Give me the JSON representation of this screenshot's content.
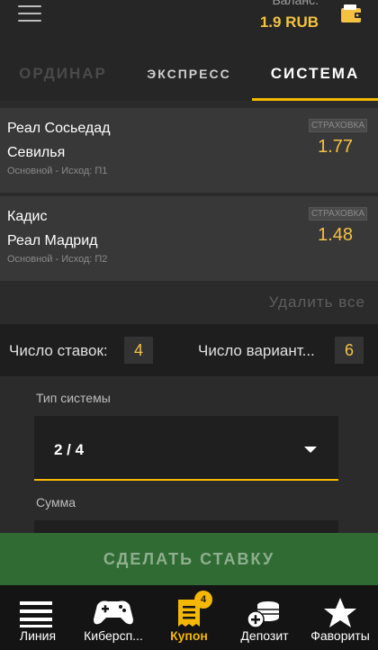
{
  "header": {
    "balance_label": "Баланс:",
    "balance_value": "1.9 RUB"
  },
  "tabs": [
    {
      "label": "ОРДИНАР"
    },
    {
      "label": "ЭКСПРЕСС"
    },
    {
      "label": "СИСТЕМА",
      "active": true
    }
  ],
  "bets": [
    {
      "team_a": "Реал Сосьедад",
      "team_b": "Севилья",
      "desc": "Основной - Исход: П1",
      "insurance": "СТРАХОВКА",
      "odds": "1.77"
    },
    {
      "team_a": "Кадис",
      "team_b": "Реал Мадрид",
      "desc": "Основной - Исход: П2",
      "insurance": "СТРАХОВКА",
      "odds": "1.48"
    }
  ],
  "delete_all": "Удалить все",
  "counts": {
    "bets_label": "Число ставок:",
    "bets_value": "4",
    "variants_label": "Число вариант...",
    "variants_value": "6"
  },
  "form": {
    "system_type_label": "Тип системы",
    "system_type_value": "2 / 4",
    "amount_label": "Сумма"
  },
  "submit_label": "СДЕЛАТЬ СТАВКУ",
  "nav": [
    {
      "label": "Линия",
      "icon": "lines-icon"
    },
    {
      "label": "Киберсп...",
      "icon": "gamepad-icon"
    },
    {
      "label": "Купон",
      "icon": "coupon-icon",
      "active": true,
      "badge": "4"
    },
    {
      "label": "Депозит",
      "icon": "coins-plus-icon"
    },
    {
      "label": "Фавориты",
      "icon": "star-icon"
    }
  ],
  "colors": {
    "accent": "#f5b800",
    "submit_bg": "#2f6b33",
    "odds": "#f5c242"
  }
}
